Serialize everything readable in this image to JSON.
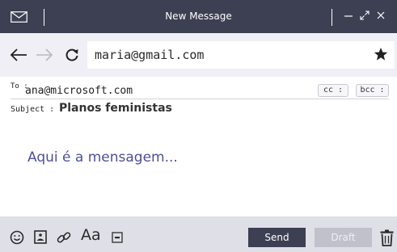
{
  "window": {
    "title": "New Message",
    "icons": [
      "mail-icon",
      "minimize-icon",
      "maximize-icon",
      "close-icon"
    ]
  },
  "urlbar": {
    "url": "maria@gmail.com",
    "icons": [
      "arrow-left-icon",
      "arrow-right-icon",
      "reload-icon",
      "star-icon"
    ]
  },
  "compose": {
    "to_label": "To :",
    "to_value": "ana@microsoft.com",
    "cc_label": "cc :",
    "bcc_label": "bcc :",
    "subject_label": "Subject :",
    "subject_value": "Planos feministas",
    "body": "Aqui é a mensagem..."
  },
  "toolbar": {
    "font_label": "Aa",
    "send_label": "Send",
    "draft_label": "Draft",
    "icons": [
      "smile-icon",
      "image-icon",
      "link-icon",
      "font-icon",
      "gif-icon",
      "trash-icon"
    ]
  },
  "colors": {
    "titlebar": "#3d3f52",
    "urlbar": "#efeff5",
    "bottombar": "#dfdfe8",
    "body_text": "#4d4f9a",
    "send": "#3d3f52",
    "draft": "#c1c1cc"
  }
}
